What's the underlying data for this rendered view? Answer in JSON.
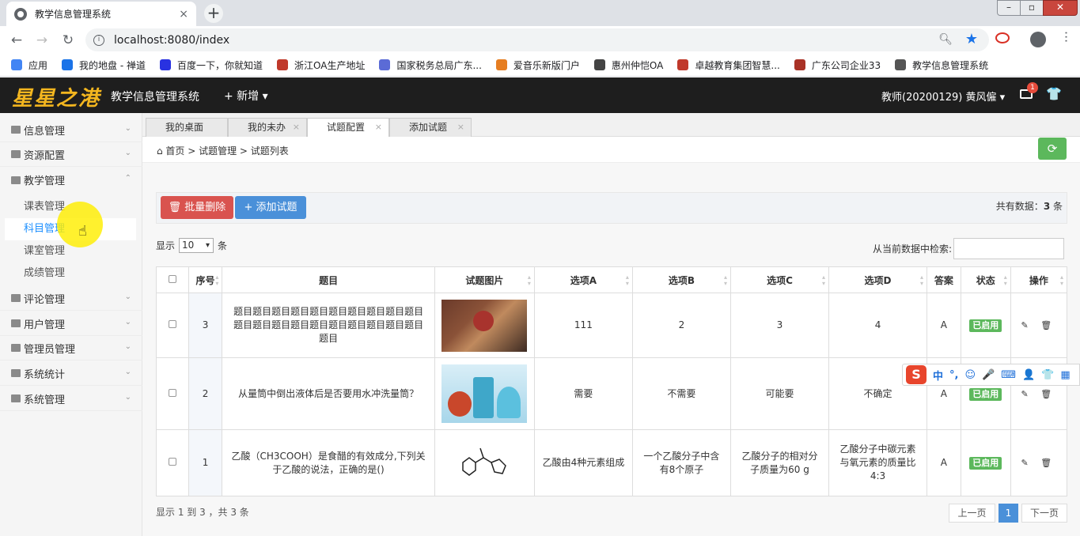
{
  "browser": {
    "tab_title": "教学信息管理系统",
    "tab_close": "×",
    "new_tab": "+",
    "url": "localhost:8080/index",
    "window_controls": {
      "min": "–",
      "max": "▫",
      "close": "✕"
    },
    "bookmarks": [
      {
        "label": "应用",
        "color": "#4285f4"
      },
      {
        "label": "我的地盘 - 禅道",
        "color": "#1a73e8"
      },
      {
        "label": "百度一下，你就知道",
        "color": "#2932e1"
      },
      {
        "label": "浙江OA生产地址",
        "color": "#c0392b"
      },
      {
        "label": "国家税务总局广东...",
        "color": "#5b6bd6"
      },
      {
        "label": "爱音乐新版门户",
        "color": "#e67e22"
      },
      {
        "label": "惠州仲恺OA",
        "color": "#444444"
      },
      {
        "label": "卓越教育集团智慧...",
        "color": "#c0392b"
      },
      {
        "label": "广东公司企业33",
        "color": "#a93226"
      },
      {
        "label": "教学信息管理系统",
        "color": "#555555"
      }
    ]
  },
  "app": {
    "logo": "星星之港",
    "title": "教学信息管理系统",
    "add_menu": "+ 新增 ▾",
    "user": "教师(20200129)  黄风僱 ▾",
    "mail_count": "1",
    "shirt_icon": "👕"
  },
  "sidebar": {
    "items": [
      {
        "label": "信息管理",
        "chev": "⌄"
      },
      {
        "label": "资源配置",
        "chev": "⌄"
      },
      {
        "label": "教学管理",
        "chev": "⌃"
      },
      {
        "label": "评论管理",
        "chev": "⌄"
      },
      {
        "label": "用户管理",
        "chev": "⌄"
      },
      {
        "label": "管理员管理",
        "chev": "⌄"
      },
      {
        "label": "系统统计",
        "chev": "⌄"
      },
      {
        "label": "系统管理",
        "chev": "⌄"
      }
    ],
    "sub_items": [
      "课表管理",
      "科目管理",
      "课室管理",
      "成绩管理"
    ],
    "collapse": "◀"
  },
  "tabs": [
    {
      "label": "我的桌面",
      "close": ""
    },
    {
      "label": "我的未办",
      "close": "×"
    },
    {
      "label": "试题配置",
      "close": "×"
    },
    {
      "label": "添加试题",
      "close": "×"
    }
  ],
  "breadcrumb": "⌂ 首页  >  试题管理  >  试题列表",
  "refresh": "⟳",
  "actions": {
    "delete_label": "🗑 批量删除",
    "add_label": "+ 添加试题",
    "total_prefix": "共有数据：",
    "total_count": "3",
    "total_suffix": " 条"
  },
  "length": {
    "prefix": "显示",
    "value": "10",
    "suffix": "条"
  },
  "search_label": "从当前数据中检索:",
  "columns": [
    "序号",
    "题目",
    "试题图片",
    "选项A",
    "选项B",
    "选项C",
    "选项D",
    "答案",
    "状态",
    "操作"
  ],
  "rows": [
    {
      "seq": "3",
      "question": "题目题目题目题目题目题目题目题目题目题目题目题目题目题目题目题目题目题目题目题目题目",
      "image": "study-photo",
      "a": "111",
      "b": "2",
      "c": "3",
      "d": "4",
      "answer": "A",
      "status": "已启用"
    },
    {
      "seq": "2",
      "question": "从量筒中倒出液体后是否要用水冲洗量筒？",
      "image": "lab-flasks-photo",
      "a": "需要",
      "b": "不需要",
      "c": "可能要",
      "d": "不确定",
      "answer": "A",
      "status": "已启用"
    },
    {
      "seq": "1",
      "question": "乙酸（CH3COOH）是食醋的有效成分,下列关于乙酸的说法，正确的是()",
      "image": "molecule-diagram",
      "a": "乙酸由4种元素组成",
      "b": "一个乙酸分子中含有8个原子",
      "c": "乙酸分子的相对分子质量为60 g",
      "d": "乙酸分子中碳元素与氧元素的质量比4:3",
      "answer": "A",
      "status": "已启用"
    }
  ],
  "ops_icons": "✎ 🗑",
  "footer_info": "显示 1 到 3 ，共 3 条",
  "pager": {
    "prev": "上一页",
    "current": "1",
    "next": "下一页"
  },
  "ime": {
    "logo": "S",
    "items": [
      "中",
      "°,",
      "☺",
      "🎤",
      "⌨",
      "👤",
      "👕",
      "▦"
    ]
  }
}
